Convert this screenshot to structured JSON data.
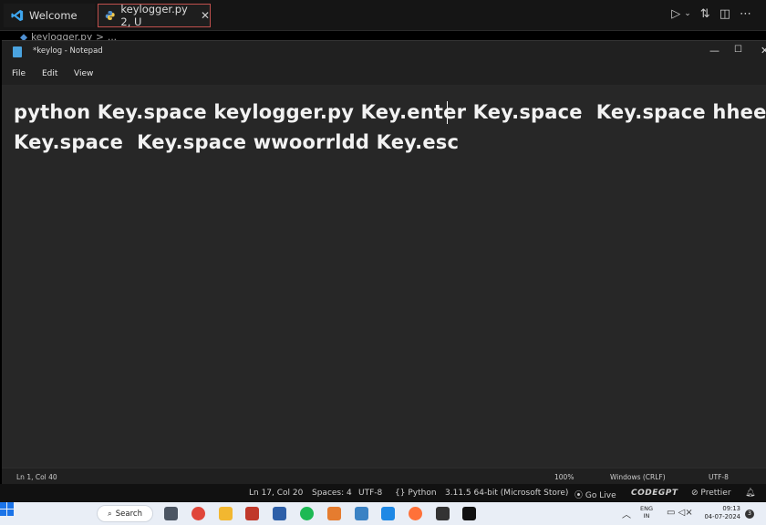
{
  "vscode": {
    "tabs": [
      {
        "label": "Welcome",
        "icon": "vscode-logo-icon"
      },
      {
        "label": "keylogger.py 2, U",
        "icon": "python-file-icon"
      }
    ],
    "breadcrumb": [
      "keylogger.py",
      ">",
      "..."
    ],
    "right_icons": [
      "run-icon",
      "chevron-down-icon",
      "source-control-icon",
      "split-editor-icon",
      "more-icon"
    ]
  },
  "notepad": {
    "title": "*keylog - Notepad",
    "menu": [
      "File",
      "Edit",
      "View"
    ],
    "content_lines": [
      "python Key.space keylogger.py Key.enter Key.space  Key.space hheellloo",
      "Key.space  Key.space wwoorrldd Key.esc"
    ],
    "status": {
      "position": "Ln 1, Col 40",
      "zoom": "100%",
      "line_endings": "Windows (CRLF)",
      "encoding": "UTF-8"
    }
  },
  "vscode_status": {
    "position": "Ln 17, Col 20",
    "spaces": "Spaces: 4",
    "encoding": "UTF-8",
    "language": "Python",
    "interpreter": "3.11.5 64-bit (Microsoft Store)",
    "go_live": "Go Live",
    "codegpt": "CODEGPT",
    "prettier": "Prettier"
  },
  "taskbar": {
    "search_label": "Search",
    "lang_top": "ENG",
    "lang_bottom": "IN",
    "time": "09:13",
    "date": "04-07-2024",
    "badge": "3",
    "apps": [
      {
        "icon": "chat-icon",
        "color": "#4b5563"
      },
      {
        "icon": "chrome-icon",
        "color": "#e0463a"
      },
      {
        "icon": "file-explorer-icon",
        "color": "#f2b730"
      },
      {
        "icon": "app-red-icon",
        "color": "#c0392b"
      },
      {
        "icon": "store-icon",
        "color": "#2d5fa8"
      },
      {
        "icon": "spotify-icon",
        "color": "#1db954"
      },
      {
        "icon": "app-pinwheel-icon",
        "color": "#e57c2f"
      },
      {
        "icon": "notepad-icon",
        "color": "#3b82c4"
      },
      {
        "icon": "vscode-icon",
        "color": "#1e88e5"
      },
      {
        "icon": "firefox-icon",
        "color": "#ff7139"
      },
      {
        "icon": "terminal-icon",
        "color": "#333333"
      },
      {
        "icon": "console-icon",
        "color": "#111111"
      }
    ]
  }
}
